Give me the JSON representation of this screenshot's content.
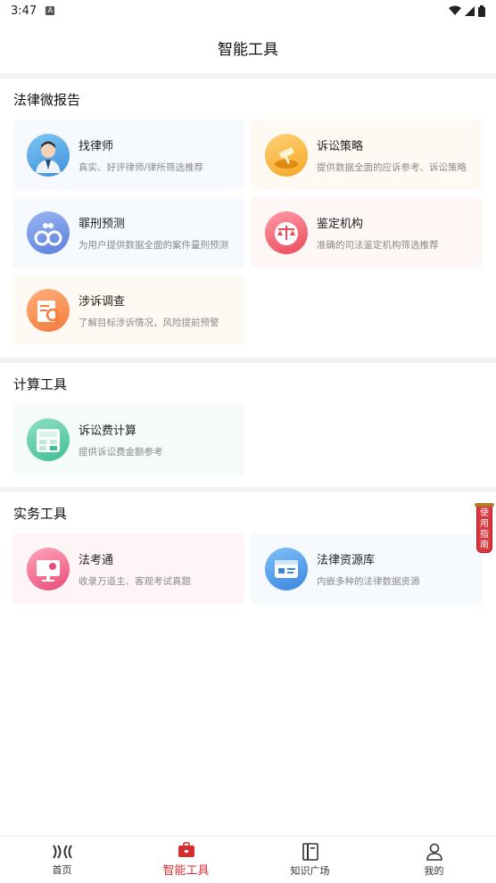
{
  "status": {
    "time": "3:47",
    "badge": "A"
  },
  "header": {
    "title": "智能工具"
  },
  "sections": {
    "legal": {
      "title": "法律微报告",
      "cards": [
        {
          "title": "找律师",
          "desc": "真实、好评律师/律所筛选推荐"
        },
        {
          "title": "诉讼策略",
          "desc": "提供数据全面的应诉参考、诉讼策略"
        },
        {
          "title": "罪刑预测",
          "desc": "为用户提供数据全面的案件量刑预测"
        },
        {
          "title": "鉴定机构",
          "desc": "准确的司法鉴定机构筛选推荐"
        },
        {
          "title": "涉诉调查",
          "desc": "了解目标涉诉情况，风险提前预警"
        }
      ]
    },
    "calc": {
      "title": "计算工具",
      "cards": [
        {
          "title": "诉讼费计算",
          "desc": "提供诉讼费金额参考"
        }
      ]
    },
    "practice": {
      "title": "实务工具",
      "cards": [
        {
          "title": "法考通",
          "desc": "收录万道主、客观考试真题"
        },
        {
          "title": "法律资源库",
          "desc": "内嵌多种的法律数据资源"
        }
      ]
    }
  },
  "guide": {
    "label": "使用指南"
  },
  "tabbar": {
    "items": [
      {
        "label": "首页"
      },
      {
        "label": "智能工具"
      },
      {
        "label": "知识广场"
      },
      {
        "label": "我的"
      }
    ],
    "active_color": "#d62e2e"
  }
}
